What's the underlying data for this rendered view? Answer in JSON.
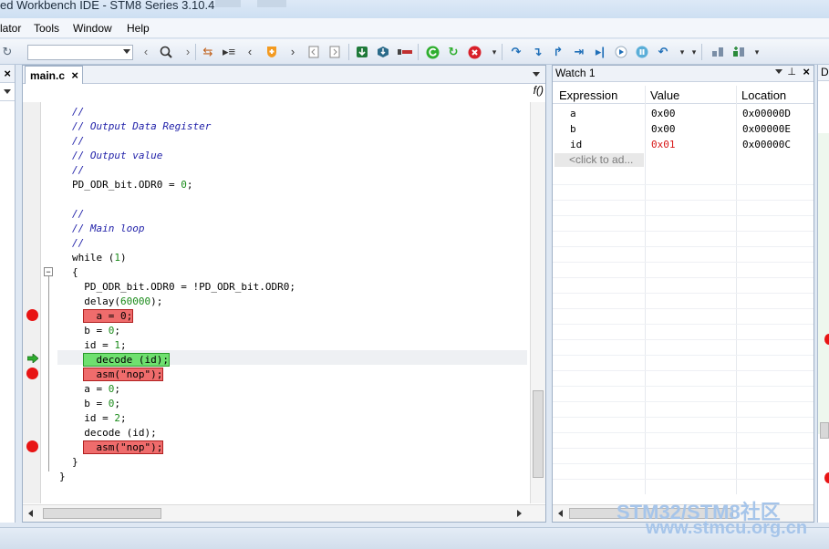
{
  "window": {
    "title": "ed Workbench IDE - STM8 Series 3.10.4"
  },
  "menu": {
    "items": [
      "lator",
      "Tools",
      "Window",
      "Help"
    ]
  },
  "toolbar": {
    "combo_value": ""
  },
  "editor": {
    "tab_label": "main.c",
    "tab_close": "×",
    "func_button": "f()",
    "code_lines": [
      "//",
      "// Output Data Register",
      "//",
      "// Output value",
      "//",
      "PD_ODR_bit.ODR0 = 0;",
      "",
      "//",
      "// Main loop",
      "//",
      "while (1)",
      "{",
      "  PD_ODR_bit.ODR0 = !PD_ODR_bit.ODR0;",
      "  delay(60000);",
      "  a = 0;",
      "  b = 0;",
      "  id = 1;",
      "  decode (id);",
      "  asm(\"nop\");",
      "  a = 0;",
      "  b = 0;",
      "  id = 2;",
      "  decode (id);",
      "  asm(\"nop\");",
      "}",
      "}"
    ]
  },
  "watch": {
    "title": "Watch 1",
    "columns": [
      "Expression",
      "Value",
      "Location"
    ],
    "rows": [
      {
        "expr": "a",
        "value": "0x00",
        "loc": "0x00000D"
      },
      {
        "expr": "b",
        "value": "0x00",
        "loc": "0x00000E"
      },
      {
        "expr": "id",
        "value": "0x01",
        "loc": "0x00000C"
      }
    ],
    "add_hint": "<click to ad...",
    "changed_color": "#d81818"
  },
  "right_panel": {
    "label": "D"
  },
  "left_panel": {
    "close": "×"
  },
  "watermark": {
    "line1": "STM32/STM8社区",
    "line2": "www.stmcu.org.cn"
  }
}
